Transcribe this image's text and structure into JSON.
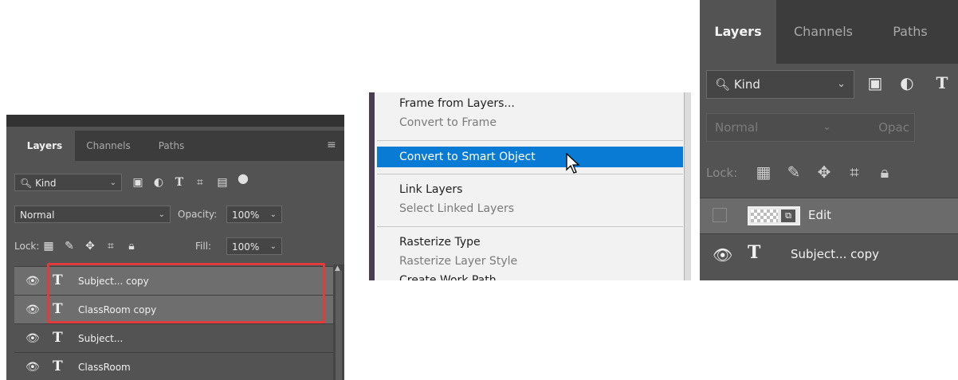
{
  "panel1": {
    "tabs": [
      "Layers",
      "Channels",
      "Paths"
    ],
    "filter_dropdown": "Kind",
    "blend_mode": "Normal",
    "opacity_label": "Opacity:",
    "opacity_value": "100%",
    "lock_label": "Lock:",
    "fill_label": "Fill:",
    "fill_value": "100%",
    "layers": [
      {
        "type_icon": "T",
        "name": "Subject... copy",
        "selected": true
      },
      {
        "type_icon": "T",
        "name": "ClassRoom copy",
        "selected": true
      },
      {
        "type_icon": "T",
        "name": "Subject...",
        "selected": false
      },
      {
        "type_icon": "T",
        "name": "ClassRoom",
        "selected": false
      }
    ],
    "highlight_color": "#e03c3c"
  },
  "panel2": {
    "items": {
      "frame_from_layers": "Frame from Layers...",
      "convert_to_frame": "Convert to Frame",
      "convert_to_smart_object": "Convert to Smart Object",
      "link_layers": "Link Layers",
      "select_linked_layers": "Select Linked Layers",
      "rasterize_type": "Rasterize Type",
      "rasterize_layer_style": "Rasterize Layer Style",
      "create_work_path": "Create Work Path"
    },
    "highlight_color": "#0a7bd4"
  },
  "panel3": {
    "tabs": [
      "Layers",
      "Channels",
      "Paths"
    ],
    "filter_dropdown": "Kind",
    "blend_mode": "Normal",
    "opacity_label": "Opac",
    "lock_label": "Lock:",
    "layers": [
      {
        "type_icon": "smart-object",
        "name": "Edit",
        "selected": true
      },
      {
        "type_icon": "T",
        "name": "Subject... copy",
        "selected": false
      }
    ]
  }
}
